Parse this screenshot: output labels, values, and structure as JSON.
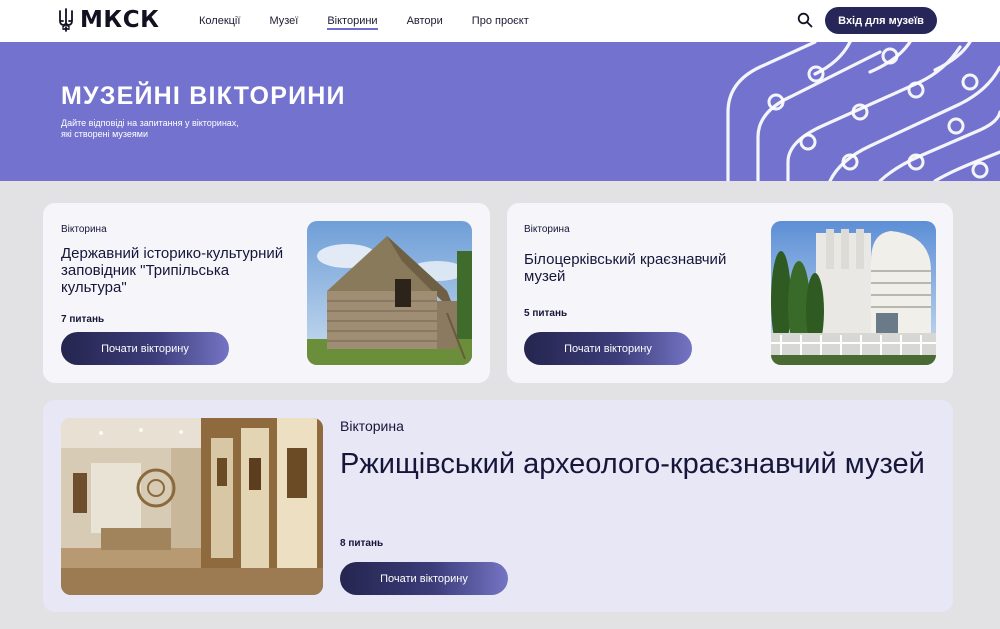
{
  "header": {
    "logo_text": "МКСК",
    "nav": [
      "Колекції",
      "Музеї",
      "Вікторини",
      "Автори",
      "Про проєкт"
    ],
    "active_nav": "Вікторини",
    "login_label": "Вхід для музеїв"
  },
  "hero": {
    "title": "МУЗЕЙНІ ВІКТОРИНИ",
    "subtitle_line1": "Дайте відповіді на запитання у вікторинах,",
    "subtitle_line2": "які створені музеями"
  },
  "quizzes": [
    {
      "tag": "Вікторина",
      "title": "Державний історико-культурний заповідник \"Трипільська культура\"",
      "questions": "7 питань",
      "button": "Почати вікторину",
      "image_icon": "thatched-house-photo"
    },
    {
      "tag": "Вікторина",
      "title": "Білоцерківський краєзнавчий музей",
      "questions": "5 питань",
      "button": "Почати вікторину",
      "image_icon": "museum-building-photo"
    },
    {
      "tag": "Вікторина",
      "title": "Ржищівський археолого-краєзнавчий музей",
      "questions": "8 питань",
      "button": "Почати вікторину",
      "image_icon": "exhibition-hall-photo"
    }
  ],
  "colors": {
    "hero_bg": "#7373cf",
    "button_dark": "#262659",
    "card_bg": "#f6f6fa",
    "featured_card_bg": "#e7e7f6",
    "page_bg": "#e2e2e4"
  }
}
